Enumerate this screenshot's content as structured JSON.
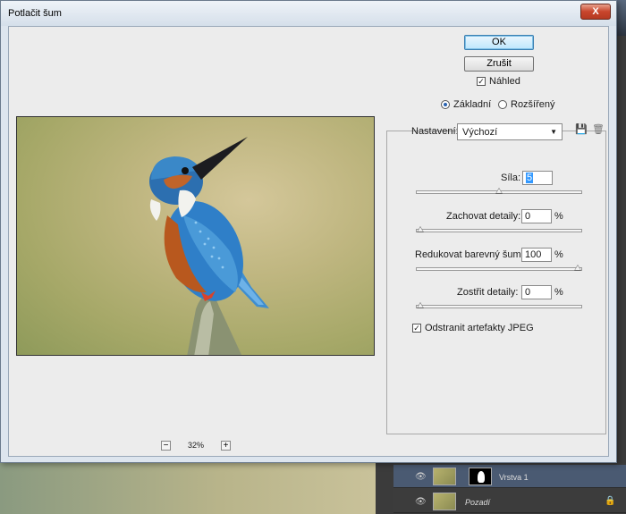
{
  "window": {
    "title": "Potlačit šum",
    "close_label": "X"
  },
  "buttons": {
    "ok_label": "OK",
    "cancel_label": "Zrušit"
  },
  "preview_option": {
    "label": "Náhled",
    "checked": true
  },
  "mode": {
    "basic_label": "Základní",
    "advanced_label": "Rozšířený",
    "selected": "Základní"
  },
  "preset": {
    "label": "Nastavení:",
    "value": "Výchozí"
  },
  "controls": {
    "strength": {
      "label": "Síla:",
      "value": "5",
      "unit": "",
      "fraction": 0.5
    },
    "preserve_details": {
      "label": "Zachovat detaily:",
      "value": "0",
      "unit": "%",
      "fraction": 0.0
    },
    "reduce_color_noise": {
      "label": "Redukovat barevný šum:",
      "value": "100",
      "unit": "%",
      "fraction": 1.0
    },
    "sharpen_details": {
      "label": "Zostřit detaily:",
      "value": "0",
      "unit": "%",
      "fraction": 0.0
    }
  },
  "remove_jpeg": {
    "label": "Odstranit artefakty JPEG",
    "checked": true
  },
  "zoom": {
    "level": "32%",
    "minus": "−",
    "plus": "+"
  },
  "layers": [
    {
      "name": "Vrstva 1"
    },
    {
      "name": "Pozadí"
    }
  ],
  "icons": {
    "close": "close-icon",
    "save_preset": "save-preset-icon",
    "delete_preset": "trash-icon",
    "dropdown": "chevron-down-icon",
    "eye": "eye-icon",
    "lock": "lock-icon",
    "zoom_out": "zoom-out-icon",
    "zoom_in": "zoom-in-icon"
  }
}
